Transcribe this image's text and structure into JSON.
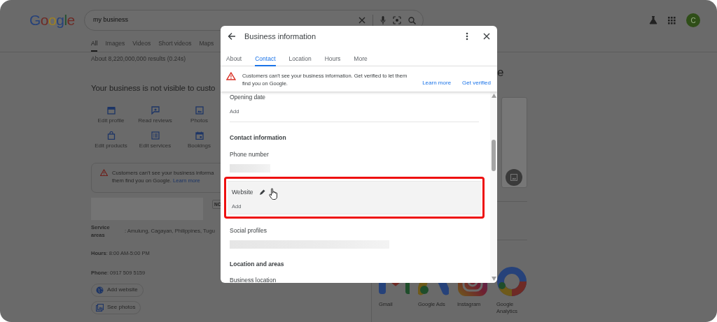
{
  "browser_header": {
    "logo": "Google",
    "search": {
      "value": "my business"
    },
    "avatar": "C"
  },
  "search_tabs": [
    {
      "label": "All",
      "selected": true
    },
    {
      "label": "Images",
      "selected": false
    },
    {
      "label": "Videos",
      "selected": false
    },
    {
      "label": "Short videos",
      "selected": false
    },
    {
      "label": "Maps",
      "selected": false
    }
  ],
  "result_stats": "About 8,220,000,000 results (0.24s)",
  "business_panel": {
    "heading": "Your business is not visible to custo",
    "actions": [
      {
        "label": "Edit profile",
        "kind": "profile"
      },
      {
        "label": "Read reviews",
        "kind": "reviews"
      },
      {
        "label": "Photos",
        "kind": "photos"
      },
      {
        "label": "Edit products",
        "kind": "products"
      },
      {
        "label": "Edit services",
        "kind": "services"
      },
      {
        "label": "Bookings",
        "kind": "bookings"
      }
    ],
    "alert": {
      "line_1": "Customers can't see your business informa",
      "line_2": "them find you on Google.",
      "link": "Learn more"
    },
    "badge": "NC",
    "service_areas": {
      "label": "Service areas",
      "value": ": Amulung, Cagayan, Philippines, Tugu"
    },
    "details": [
      "**Hours**: 8:00 AM-5:00 PM",
      "**Phone**: 0917 509 5159"
    ],
    "buttons": [
      {
        "label": "Add website",
        "kind": "globe"
      },
      {
        "label": "See photos",
        "kind": "photos"
      }
    ]
  },
  "side_panel": {
    "heading_fragment": "e",
    "apps": [
      {
        "label": "Gmail",
        "kind": "gmail"
      },
      {
        "label": "Google Ads",
        "kind": "ads"
      },
      {
        "label": "Instagram",
        "kind": "instagram"
      },
      {
        "label": "Google Analytics",
        "kind": "analytics"
      }
    ]
  },
  "dialog": {
    "title": "Business information",
    "tabs": [
      {
        "label": "About",
        "selected": false
      },
      {
        "label": "Contact",
        "selected": true
      },
      {
        "label": "Location",
        "selected": false
      },
      {
        "label": "Hours",
        "selected": false
      },
      {
        "label": "More",
        "selected": false
      }
    ],
    "banner": {
      "text": "Customers can't see your business information. Get verified to let them find you on Google.",
      "links": [
        "Learn more",
        "Get verified"
      ]
    },
    "sections": [
      {
        "kind": "field",
        "label": "Opening date",
        "value": "Add",
        "divider": true
      },
      {
        "kind": "heading",
        "label": "Contact information"
      },
      {
        "kind": "field",
        "label": "Phone number",
        "redacted": true
      },
      {
        "kind": "field",
        "label": "Website",
        "value": "Add",
        "highlighted": true
      },
      {
        "kind": "field",
        "label": "Social profiles",
        "redacted": true
      },
      {
        "kind": "heading",
        "label": "Location and areas"
      },
      {
        "kind": "field",
        "label": "Business location"
      }
    ]
  }
}
